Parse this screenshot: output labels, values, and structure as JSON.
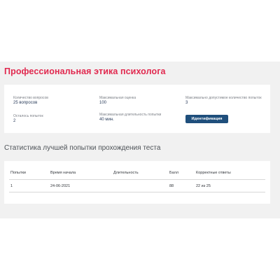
{
  "page": {
    "title": "Профессиональная этика психолога"
  },
  "info": {
    "questions_count": {
      "label": "Количество вопросов",
      "value": "25 вопросов"
    },
    "max_score": {
      "label": "Максимальная оценка",
      "value": "100"
    },
    "max_attempts": {
      "label": "Максимально допустимое количество попыток",
      "value": "3"
    },
    "attempts_left": {
      "label": "Осталось попыток",
      "value": "2"
    },
    "max_duration": {
      "label": "Максимальная длительность попытки",
      "value": "40 мин."
    },
    "identify_button": "Идентификация"
  },
  "stats": {
    "title": "Статистика лучшей попытки прохождения теста",
    "columns": [
      "Попытки",
      "Время начала",
      "Длительность",
      "Балл",
      "Корректные ответы"
    ],
    "rows": [
      [
        "1",
        "24-06-2021",
        "",
        "88",
        "22 из 25"
      ]
    ]
  },
  "colors": {
    "title_accent": "#e1294f",
    "button_bg": "#1f4f7c",
    "content_bg": "#f1f1f1",
    "value_text": "#2c3e5c"
  }
}
